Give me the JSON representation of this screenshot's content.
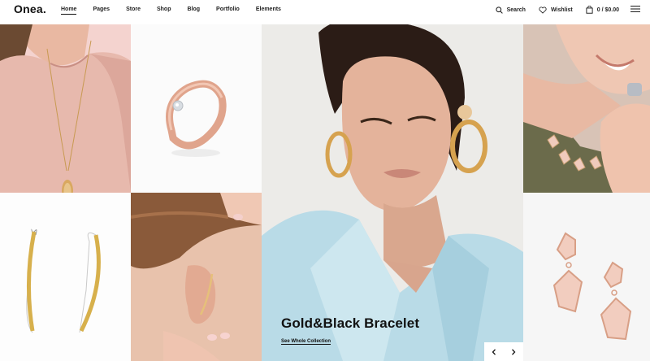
{
  "header": {
    "logo": "Onea.",
    "nav": [
      "Home",
      "Pages",
      "Store",
      "Shop",
      "Blog",
      "Portfolio",
      "Elements"
    ],
    "search_label": "Search",
    "wishlist_label": "Wishlist",
    "cart_label": "0 / $0.00"
  },
  "hero": {
    "title": "Gold&Black Bracelet",
    "link": "See Whole Collection"
  },
  "colors": {
    "accent": "#111111",
    "pink_bg": "#f4d3cf",
    "gold": "#d8b15a",
    "rose_gold": "#e7b19d"
  },
  "icons": [
    "search-icon",
    "heart-icon",
    "bag-icon",
    "hamburger-menu-icon",
    "chevron-left-icon",
    "chevron-right-icon"
  ]
}
